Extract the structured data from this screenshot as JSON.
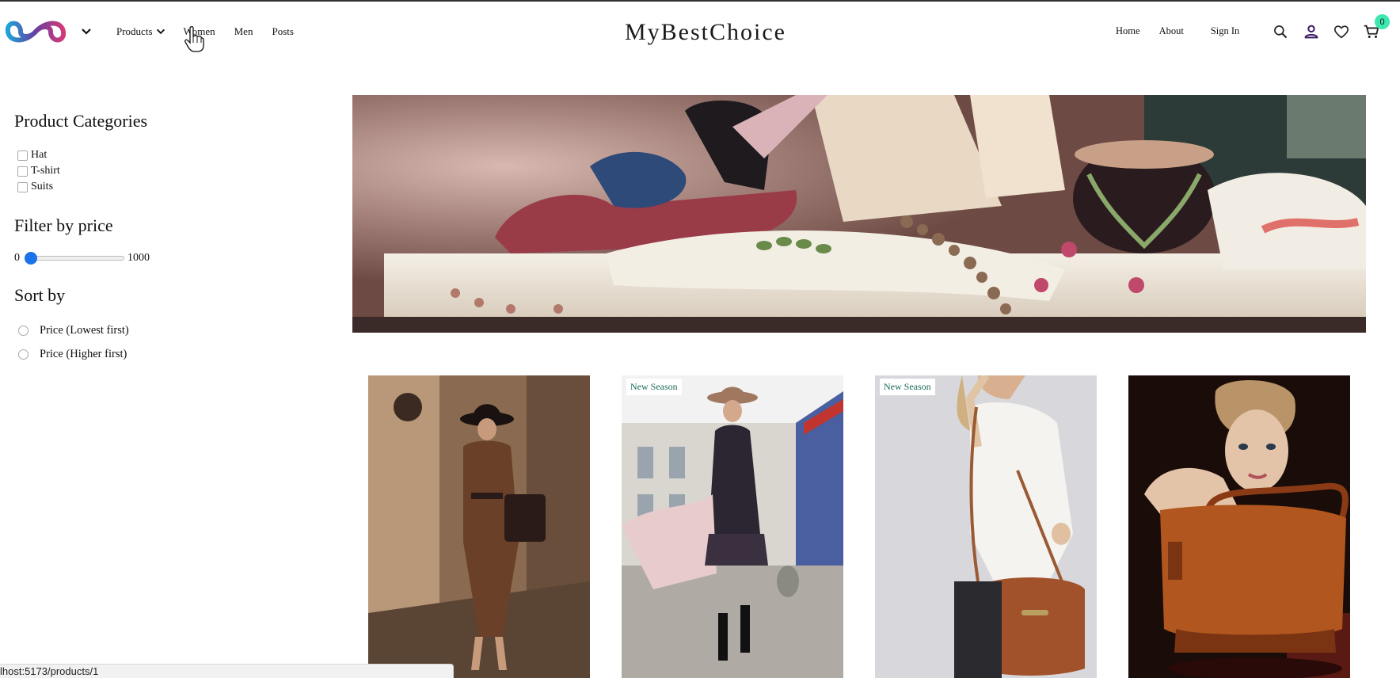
{
  "header": {
    "brand": "MyBestChoice",
    "nav_left": {
      "products": "Products",
      "women": "Women",
      "men": "Men",
      "posts": "Posts"
    },
    "nav_right": {
      "home": "Home",
      "about": "About",
      "sign_in": "Sign In"
    },
    "cart_count": "0",
    "icons": [
      "logo-icon",
      "chevron-down-icon",
      "search-icon",
      "account-icon",
      "heart-icon",
      "cart-icon"
    ],
    "accent_color": "#3ee6b0"
  },
  "sidebar": {
    "categories_title": "Product Categories",
    "categories": [
      "Hat",
      "T-shirt",
      "Suits"
    ],
    "price_title": "Filter by price",
    "price_min": "0",
    "price_max": "1000",
    "price_value": 0,
    "sort_title": "Sort by",
    "sort_options": [
      "Price (Lowest first)",
      "Price (Higher first)"
    ]
  },
  "products": [
    {
      "badge": ""
    },
    {
      "badge": "New Season"
    },
    {
      "badge": "New Season"
    },
    {
      "badge": ""
    }
  ],
  "status_url": "lhost:5173/products/1"
}
